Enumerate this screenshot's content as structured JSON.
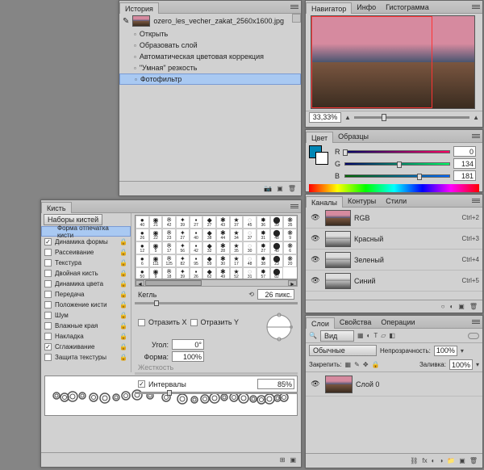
{
  "history": {
    "title": "История",
    "filename": "ozero_les_vecher_zakat_2560x1600.jpg",
    "items": [
      {
        "label": "Открыть",
        "sel": false
      },
      {
        "label": "Образовать слой",
        "sel": false
      },
      {
        "label": "Автоматическая цветовая коррекция",
        "sel": false
      },
      {
        "label": "\"Умная\" резкость",
        "sel": false
      },
      {
        "label": "Фотофильтр",
        "sel": true
      }
    ]
  },
  "navigator": {
    "tabs": [
      "Навигатор",
      "Инфо",
      "Гистограмма"
    ],
    "zoom": "33,33%"
  },
  "color": {
    "tabs": [
      "Цвет",
      "Образцы"
    ],
    "r": {
      "label": "R",
      "value": "0"
    },
    "g": {
      "label": "G",
      "value": "134"
    },
    "b": {
      "label": "B",
      "value": "181"
    }
  },
  "channels": {
    "tabs": [
      "Каналы",
      "Контуры",
      "Стили"
    ],
    "items": [
      {
        "name": "RGB",
        "shortcut": "Ctrl+2",
        "color": true
      },
      {
        "name": "Красный",
        "shortcut": "Ctrl+3",
        "color": false
      },
      {
        "name": "Зеленый",
        "shortcut": "Ctrl+4",
        "color": false
      },
      {
        "name": "Синий",
        "shortcut": "Ctrl+5",
        "color": false
      }
    ]
  },
  "layers": {
    "tabs": [
      "Слои",
      "Свойства",
      "Операции"
    ],
    "filter": "Вид",
    "blend": "Обычные",
    "opacity_label": "Непрозрачность:",
    "opacity_value": "100%",
    "lock_label": "Закрепить:",
    "fill_label": "Заливка:",
    "fill_value": "100%",
    "layer0": "Слой 0"
  },
  "brush": {
    "title": "Кисть",
    "presets": "Наборы кистей",
    "sections": [
      {
        "label": "Форма отпечатка кисти",
        "checked": null,
        "lock": false,
        "active": true
      },
      {
        "label": "Динамика формы",
        "checked": true,
        "lock": true
      },
      {
        "label": "Рассеивание",
        "checked": false,
        "lock": true
      },
      {
        "label": "Текстура",
        "checked": false,
        "lock": true
      },
      {
        "label": "Двойная кисть",
        "checked": false,
        "lock": true
      },
      {
        "label": "Динамика цвета",
        "checked": false,
        "lock": true
      },
      {
        "label": "Передача",
        "checked": false,
        "lock": true
      },
      {
        "label": "Положение кисти",
        "checked": false,
        "lock": true
      },
      {
        "label": "Шум",
        "checked": false,
        "lock": true
      },
      {
        "label": "Влажные края",
        "checked": false,
        "lock": true
      },
      {
        "label": "Накладка",
        "checked": false,
        "lock": true
      },
      {
        "label": "Сглаживание",
        "checked": true,
        "lock": true
      },
      {
        "label": "Защита текстуры",
        "checked": false,
        "lock": true
      }
    ],
    "size_label": "Кегль",
    "size_value": "26 пикс.",
    "flip_x": "Отразить X",
    "flip_y": "Отразить Y",
    "angle_label": "Угол:",
    "angle_value": "0°",
    "form_label": "Форма:",
    "form_value": "100%",
    "hardness_label": "Жесткость",
    "spacing_label": "Интервалы",
    "spacing_value": "85%",
    "tipgrid": [
      "40",
      "21",
      "42",
      "39",
      "27",
      "27",
      "43",
      "37",
      "45",
      "36",
      "39",
      "35",
      "26",
      "22",
      "23",
      "27",
      "40",
      "38",
      "44",
      "34",
      "37",
      "31",
      "48",
      "9",
      "12",
      "5",
      "17",
      "56",
      "42",
      "32",
      "28",
      "35",
      "30",
      "27",
      "40",
      "6",
      "6",
      "111",
      "125",
      "82",
      "95",
      "59",
      "30",
      "17",
      "48",
      "38",
      "23",
      "20",
      "50",
      "9",
      "18",
      "39",
      "26",
      "62",
      "49",
      "52",
      "31",
      "57",
      "82"
    ]
  }
}
